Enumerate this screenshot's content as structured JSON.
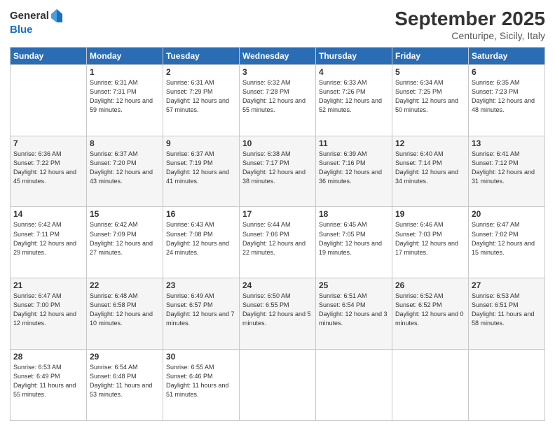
{
  "logo": {
    "general": "General",
    "blue": "Blue"
  },
  "title": "September 2025",
  "location": "Centuripe, Sicily, Italy",
  "days_header": [
    "Sunday",
    "Monday",
    "Tuesday",
    "Wednesday",
    "Thursday",
    "Friday",
    "Saturday"
  ],
  "weeks": [
    [
      {
        "day": "",
        "sunrise": "",
        "sunset": "",
        "daylight": ""
      },
      {
        "day": "1",
        "sunrise": "Sunrise: 6:31 AM",
        "sunset": "Sunset: 7:31 PM",
        "daylight": "Daylight: 12 hours and 59 minutes."
      },
      {
        "day": "2",
        "sunrise": "Sunrise: 6:31 AM",
        "sunset": "Sunset: 7:29 PM",
        "daylight": "Daylight: 12 hours and 57 minutes."
      },
      {
        "day": "3",
        "sunrise": "Sunrise: 6:32 AM",
        "sunset": "Sunset: 7:28 PM",
        "daylight": "Daylight: 12 hours and 55 minutes."
      },
      {
        "day": "4",
        "sunrise": "Sunrise: 6:33 AM",
        "sunset": "Sunset: 7:26 PM",
        "daylight": "Daylight: 12 hours and 52 minutes."
      },
      {
        "day": "5",
        "sunrise": "Sunrise: 6:34 AM",
        "sunset": "Sunset: 7:25 PM",
        "daylight": "Daylight: 12 hours and 50 minutes."
      },
      {
        "day": "6",
        "sunrise": "Sunrise: 6:35 AM",
        "sunset": "Sunset: 7:23 PM",
        "daylight": "Daylight: 12 hours and 48 minutes."
      }
    ],
    [
      {
        "day": "7",
        "sunrise": "Sunrise: 6:36 AM",
        "sunset": "Sunset: 7:22 PM",
        "daylight": "Daylight: 12 hours and 45 minutes."
      },
      {
        "day": "8",
        "sunrise": "Sunrise: 6:37 AM",
        "sunset": "Sunset: 7:20 PM",
        "daylight": "Daylight: 12 hours and 43 minutes."
      },
      {
        "day": "9",
        "sunrise": "Sunrise: 6:37 AM",
        "sunset": "Sunset: 7:19 PM",
        "daylight": "Daylight: 12 hours and 41 minutes."
      },
      {
        "day": "10",
        "sunrise": "Sunrise: 6:38 AM",
        "sunset": "Sunset: 7:17 PM",
        "daylight": "Daylight: 12 hours and 38 minutes."
      },
      {
        "day": "11",
        "sunrise": "Sunrise: 6:39 AM",
        "sunset": "Sunset: 7:16 PM",
        "daylight": "Daylight: 12 hours and 36 minutes."
      },
      {
        "day": "12",
        "sunrise": "Sunrise: 6:40 AM",
        "sunset": "Sunset: 7:14 PM",
        "daylight": "Daylight: 12 hours and 34 minutes."
      },
      {
        "day": "13",
        "sunrise": "Sunrise: 6:41 AM",
        "sunset": "Sunset: 7:12 PM",
        "daylight": "Daylight: 12 hours and 31 minutes."
      }
    ],
    [
      {
        "day": "14",
        "sunrise": "Sunrise: 6:42 AM",
        "sunset": "Sunset: 7:11 PM",
        "daylight": "Daylight: 12 hours and 29 minutes."
      },
      {
        "day": "15",
        "sunrise": "Sunrise: 6:42 AM",
        "sunset": "Sunset: 7:09 PM",
        "daylight": "Daylight: 12 hours and 27 minutes."
      },
      {
        "day": "16",
        "sunrise": "Sunrise: 6:43 AM",
        "sunset": "Sunset: 7:08 PM",
        "daylight": "Daylight: 12 hours and 24 minutes."
      },
      {
        "day": "17",
        "sunrise": "Sunrise: 6:44 AM",
        "sunset": "Sunset: 7:06 PM",
        "daylight": "Daylight: 12 hours and 22 minutes."
      },
      {
        "day": "18",
        "sunrise": "Sunrise: 6:45 AM",
        "sunset": "Sunset: 7:05 PM",
        "daylight": "Daylight: 12 hours and 19 minutes."
      },
      {
        "day": "19",
        "sunrise": "Sunrise: 6:46 AM",
        "sunset": "Sunset: 7:03 PM",
        "daylight": "Daylight: 12 hours and 17 minutes."
      },
      {
        "day": "20",
        "sunrise": "Sunrise: 6:47 AM",
        "sunset": "Sunset: 7:02 PM",
        "daylight": "Daylight: 12 hours and 15 minutes."
      }
    ],
    [
      {
        "day": "21",
        "sunrise": "Sunrise: 6:47 AM",
        "sunset": "Sunset: 7:00 PM",
        "daylight": "Daylight: 12 hours and 12 minutes."
      },
      {
        "day": "22",
        "sunrise": "Sunrise: 6:48 AM",
        "sunset": "Sunset: 6:58 PM",
        "daylight": "Daylight: 12 hours and 10 minutes."
      },
      {
        "day": "23",
        "sunrise": "Sunrise: 6:49 AM",
        "sunset": "Sunset: 6:57 PM",
        "daylight": "Daylight: 12 hours and 7 minutes."
      },
      {
        "day": "24",
        "sunrise": "Sunrise: 6:50 AM",
        "sunset": "Sunset: 6:55 PM",
        "daylight": "Daylight: 12 hours and 5 minutes."
      },
      {
        "day": "25",
        "sunrise": "Sunrise: 6:51 AM",
        "sunset": "Sunset: 6:54 PM",
        "daylight": "Daylight: 12 hours and 3 minutes."
      },
      {
        "day": "26",
        "sunrise": "Sunrise: 6:52 AM",
        "sunset": "Sunset: 6:52 PM",
        "daylight": "Daylight: 12 hours and 0 minutes."
      },
      {
        "day": "27",
        "sunrise": "Sunrise: 6:53 AM",
        "sunset": "Sunset: 6:51 PM",
        "daylight": "Daylight: 11 hours and 58 minutes."
      }
    ],
    [
      {
        "day": "28",
        "sunrise": "Sunrise: 6:53 AM",
        "sunset": "Sunset: 6:49 PM",
        "daylight": "Daylight: 11 hours and 55 minutes."
      },
      {
        "day": "29",
        "sunrise": "Sunrise: 6:54 AM",
        "sunset": "Sunset: 6:48 PM",
        "daylight": "Daylight: 11 hours and 53 minutes."
      },
      {
        "day": "30",
        "sunrise": "Sunrise: 6:55 AM",
        "sunset": "Sunset: 6:46 PM",
        "daylight": "Daylight: 11 hours and 51 minutes."
      },
      {
        "day": "",
        "sunrise": "",
        "sunset": "",
        "daylight": ""
      },
      {
        "day": "",
        "sunrise": "",
        "sunset": "",
        "daylight": ""
      },
      {
        "day": "",
        "sunrise": "",
        "sunset": "",
        "daylight": ""
      },
      {
        "day": "",
        "sunrise": "",
        "sunset": "",
        "daylight": ""
      }
    ]
  ]
}
